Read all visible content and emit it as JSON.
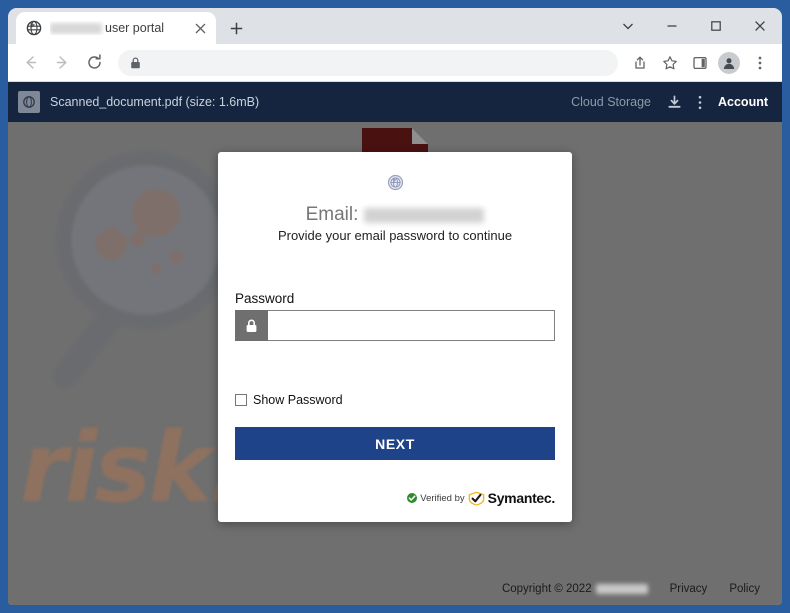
{
  "browser": {
    "tab": {
      "favicon": "globe-icon",
      "title_suffix": "user portal",
      "title_redacted": true,
      "close_label": "✕"
    },
    "new_tab_label": "+",
    "window_controls": {
      "search_tabs": "∨",
      "minimize": "–",
      "maximize": "□",
      "close": "✕"
    },
    "toolbar": {
      "back": "←",
      "forward": "→",
      "reload": "↻",
      "omnibox_value": "",
      "omnibox_placeholder": "",
      "lock_icon": "lock-icon",
      "share_icon": "share-icon",
      "bookmark_icon": "star-icon",
      "sidepanel_icon": "side-panel-icon",
      "profile_icon": "profile-avatar-icon",
      "menu_icon": "three-dot-menu-icon"
    }
  },
  "pdf_viewer": {
    "doc_icon": "document-circle-icon",
    "filename": "Scanned_document.pdf (size: 1.6mB)",
    "cloud_storage": "Cloud Storage",
    "download_icon": "download-icon",
    "more_icon": "vertical-dots-icon",
    "account": "Account"
  },
  "background": {
    "watermark_text": "risk.com",
    "magnifier_icon": "magnifying-glass-icon",
    "sheet_icon": "pdf-page-icon",
    "overlay_color": "#6f6f6f"
  },
  "modal": {
    "logo_icon": "globe-icon",
    "email_label": "Email:",
    "email_value_redacted": true,
    "subtitle": "Provide your email password to continue",
    "password_label": "Password",
    "password_value": "",
    "password_placeholder": "",
    "password_prefix_icon": "lock-icon",
    "show_password_label": "Show Password",
    "show_password_checked": false,
    "next_label": "NEXT",
    "symantec": {
      "verified_text": "Verified by",
      "brand": "Symantec.",
      "check_icon": "green-check-icon",
      "shield_icon": "symantec-check-icon"
    },
    "accent_color": "#1f4388"
  },
  "footer": {
    "copyright": "Copyright © 2022",
    "company_redacted": true,
    "privacy": "Privacy",
    "policy": "Policy"
  }
}
